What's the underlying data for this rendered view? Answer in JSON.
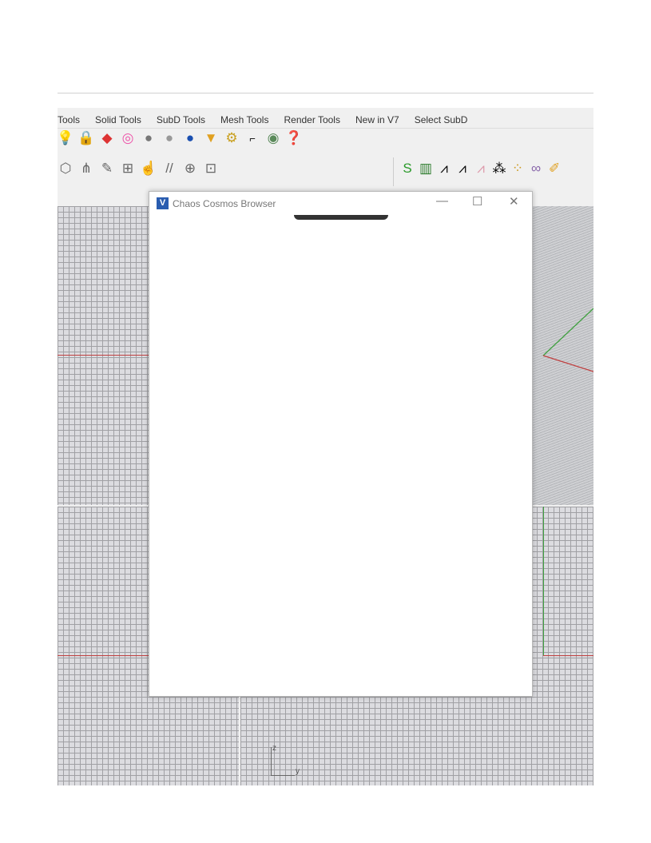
{
  "menu_tabs": [
    "Tools",
    "Solid Tools",
    "SubD Tools",
    "Mesh Tools",
    "Render Tools",
    "New in V7",
    "Select SubD"
  ],
  "toolbar_row1_icons": [
    "light-icon",
    "lock-icon",
    "material-icon",
    "color-wheel-icon",
    "sphere-grey-icon",
    "sphere-shaded-icon",
    "sphere-blue-icon",
    "filter-icon",
    "gear-icon",
    "dimension-icon",
    "render-icon",
    "help-icon"
  ],
  "toolbar_row2_icons": [
    "box-icon",
    "grass-icon",
    "pencil-icon",
    "grid-icon",
    "hand-icon",
    "lines-icon",
    "target-icon",
    "lock-frame-icon"
  ],
  "toolbar_row3_icons": [
    "curve-icon",
    "calculator-icon",
    "point-icon",
    "point-eye-icon",
    "point-arrow-icon",
    "points-icon",
    "nodes-icon",
    "glasses-icon",
    "pencil-icon"
  ],
  "dialog": {
    "title": "Chaos Cosmos Browser",
    "minimize": "—",
    "maximize": "☐",
    "close": "✕"
  },
  "axis": {
    "z": "z",
    "y": "y"
  },
  "colors": {
    "x_axis": "#c04040",
    "y_axis": "#40a040"
  }
}
